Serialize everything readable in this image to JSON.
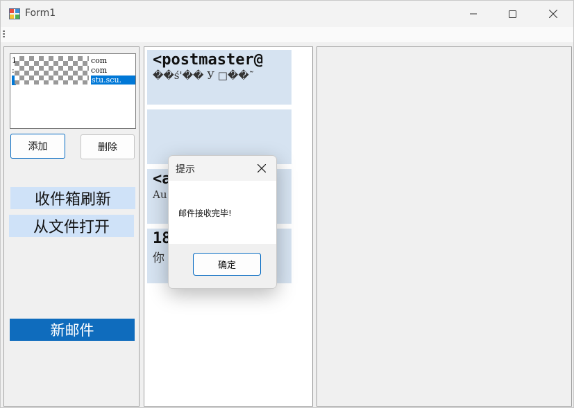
{
  "window": {
    "title": "Form1"
  },
  "accounts": {
    "rows": [
      {
        "prefix": "1",
        "suffix": "com",
        "selected": false
      },
      {
        "prefix": ":",
        "suffix": "com",
        "selected": false
      },
      {
        "prefix": "",
        "suffix": "stu.scu.",
        "selected": true
      }
    ],
    "add_label": "添加",
    "delete_label": "删除"
  },
  "actions": {
    "refresh_label": "收件箱刷新",
    "open_file_label": "从文件打开",
    "new_mail_label": "新邮件"
  },
  "mail_list": [
    {
      "from": "<postmaster@",
      "subject": "��ś'�� У □��˜"
    },
    {
      "from": "",
      "subject": ""
    },
    {
      "from": "<a",
      "subject": "Au"
    },
    {
      "from": "18",
      "subject": "你"
    }
  ],
  "dialog": {
    "title": "提示",
    "message": "邮件接收完毕!",
    "ok_label": "确定"
  },
  "colors": {
    "accent": "#0f6cbd",
    "selection": "#0078d7",
    "card": "#d6e3f1",
    "label_bg": "#cfe2f8"
  }
}
